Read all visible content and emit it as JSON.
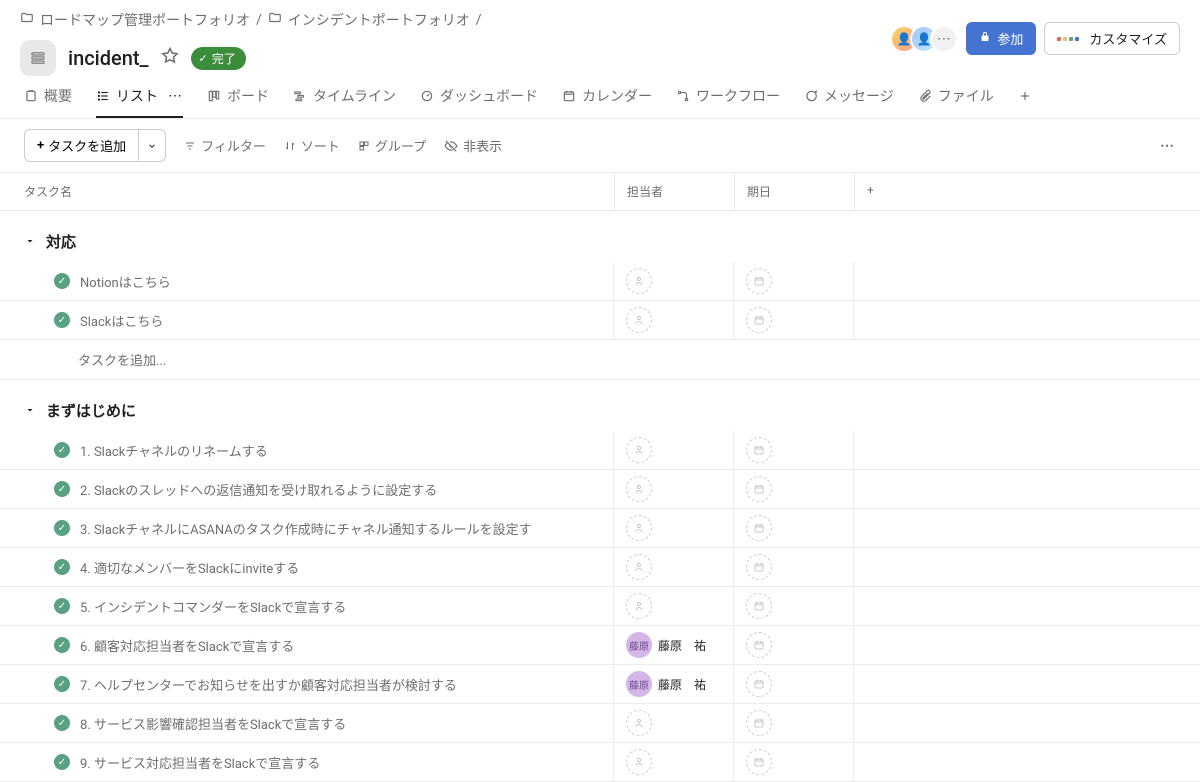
{
  "breadcrumb": [
    {
      "label": "ロードマップ管理ポートフォリオ"
    },
    {
      "label": "インシデントポートフォリオ"
    }
  ],
  "top_actions": {
    "join": "参加",
    "customize": "カスタマイズ"
  },
  "project": {
    "title": "incident_",
    "status_pill": "完了"
  },
  "tabs": [
    {
      "id": "overview",
      "label": "概要"
    },
    {
      "id": "list",
      "label": "リスト",
      "active": true
    },
    {
      "id": "board",
      "label": "ボード"
    },
    {
      "id": "timeline",
      "label": "タイムライン"
    },
    {
      "id": "dashboard",
      "label": "ダッシュボード"
    },
    {
      "id": "calendar",
      "label": "カレンダー"
    },
    {
      "id": "workflow",
      "label": "ワークフロー"
    },
    {
      "id": "message",
      "label": "メッセージ"
    },
    {
      "id": "file",
      "label": "ファイル"
    }
  ],
  "toolbar": {
    "add_task": "タスクを追加",
    "filter": "フィルター",
    "sort": "ソート",
    "group": "グループ",
    "hide": "非表示"
  },
  "columns": {
    "name": "タスク名",
    "assignee": "担当者",
    "due": "期日"
  },
  "assignee_sample": {
    "initials": "藤原",
    "name": "藤原　祐"
  },
  "sections": [
    {
      "title": "対応",
      "tasks": [
        {
          "done": true,
          "name": "Notionはこちら"
        },
        {
          "done": true,
          "name": "Slackはこちら"
        }
      ],
      "add_placeholder": "タスクを追加..."
    },
    {
      "title": "まずはじめに",
      "tasks": [
        {
          "done": true,
          "name": "1. Slackチャネルのリネームする"
        },
        {
          "done": true,
          "name": "2. Slackのスレッドへの返信通知を受け取れるように設定する"
        },
        {
          "done": true,
          "name": "3. SlackチャネルにASANAのタスク作成時にチャネル通知するルールを設定す"
        },
        {
          "done": true,
          "name": "4. 適切なメンバーをSlackにinviteする"
        },
        {
          "done": true,
          "name": "5. インシデントコマンダーをSlackで宣言する"
        },
        {
          "done": true,
          "name": "6. 顧客対応担当者をSlackで宣言する",
          "assignee": true
        },
        {
          "done": true,
          "name": "7. ヘルプセンターでお知らせを出すか顧客対応担当者が検討する",
          "assignee": true
        },
        {
          "done": true,
          "name": "8. サービス影響確認担当者をSlackで宣言する"
        },
        {
          "done": true,
          "name": "9. サービス対応担当者をSlackで宣言する"
        }
      ]
    }
  ]
}
